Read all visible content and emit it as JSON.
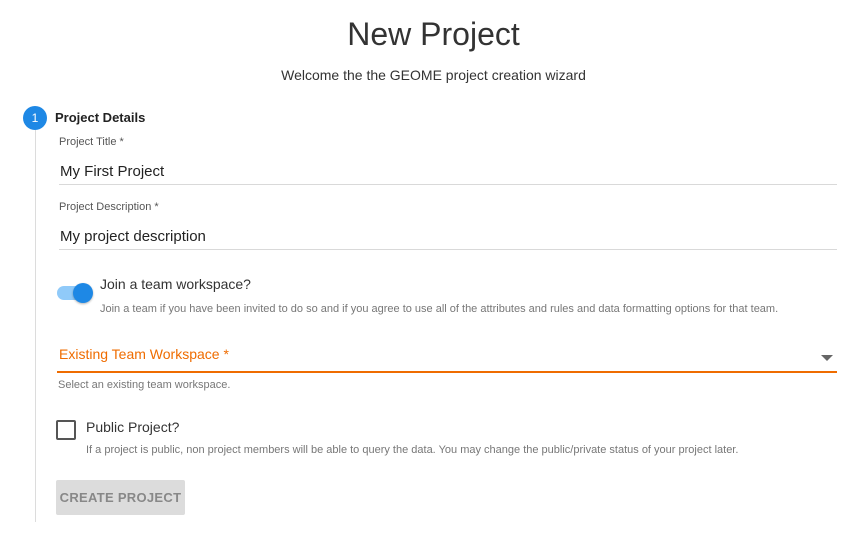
{
  "header": {
    "title": "New Project",
    "subtitle": "Welcome the the GEOME project creation wizard"
  },
  "stepper": {
    "steps": [
      {
        "number": "1",
        "label": "Project Details"
      }
    ]
  },
  "form": {
    "project_title": {
      "label": "Project Title *",
      "value": "My First Project"
    },
    "project_description": {
      "label": "Project Description *",
      "value": "My project description"
    },
    "join_team": {
      "label": "Join a team workspace?",
      "hint": "Join a team if you have been invited to do so and if you agree to use all of the attributes and rules and data formatting options for that team.",
      "checked": true
    },
    "team_workspace": {
      "label": "Existing Team Workspace *",
      "hint": "Select an existing team workspace.",
      "value": ""
    },
    "public_project": {
      "label": "Public Project?",
      "hint": "If a project is public, non project members will be able to query the data. You may change the public/private status of your project later.",
      "checked": false
    },
    "submit_label": "CREATE PROJECT"
  },
  "colors": {
    "accent": "#1e88e5",
    "accent_light": "#90caf9",
    "warn": "#ef6c00",
    "disabled_bg": "#dcdcdc"
  },
  "icons": {
    "select_arrow": "caret-down-icon"
  }
}
